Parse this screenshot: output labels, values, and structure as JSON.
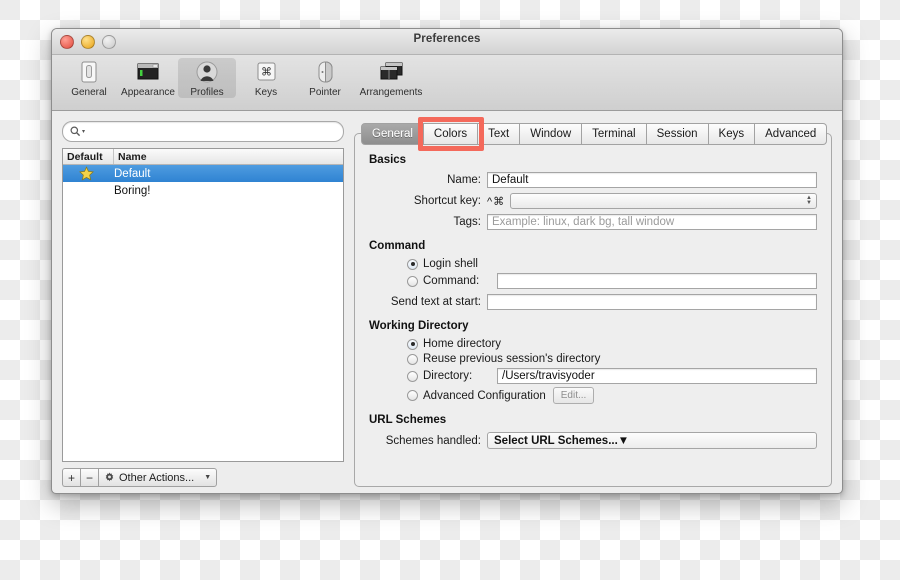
{
  "window": {
    "title": "Preferences",
    "traffic_lights": [
      "close-button",
      "minimize-button",
      "zoom-button"
    ]
  },
  "toolbar": {
    "items": [
      {
        "label": "General",
        "icon": "light-switch-icon",
        "active": false
      },
      {
        "label": "Appearance",
        "icon": "terminal-window-icon",
        "active": false
      },
      {
        "label": "Profiles",
        "icon": "person-silhouette-icon",
        "active": true
      },
      {
        "label": "Keys",
        "icon": "command-key-icon",
        "active": false
      },
      {
        "label": "Pointer",
        "icon": "mouse-icon",
        "active": false
      },
      {
        "label": "Arrangements",
        "icon": "stacked-windows-icon",
        "active": false
      }
    ]
  },
  "sidebar": {
    "search": {
      "placeholder": "",
      "value": "",
      "icon": "search-icon"
    },
    "columns": [
      "Default",
      "Name"
    ],
    "rows": [
      {
        "name": "Default",
        "starred": true,
        "selected": true
      },
      {
        "name": "Boring!",
        "starred": false,
        "selected": false
      }
    ],
    "bottom_bar": {
      "add_label": "+",
      "remove_label": "−",
      "other_actions_label": "Other Actions...",
      "gear_icon": "gear-icon",
      "caret_icon": "chevron-down-icon"
    }
  },
  "tabs": [
    {
      "label": "General",
      "selected": true,
      "highlighted": false
    },
    {
      "label": "Colors",
      "selected": false,
      "highlighted": true
    },
    {
      "label": "Text",
      "selected": false,
      "highlighted": false
    },
    {
      "label": "Window",
      "selected": false,
      "highlighted": false
    },
    {
      "label": "Terminal",
      "selected": false,
      "highlighted": false
    },
    {
      "label": "Session",
      "selected": false,
      "highlighted": false
    },
    {
      "label": "Keys",
      "selected": false,
      "highlighted": false
    },
    {
      "label": "Advanced",
      "selected": false,
      "highlighted": false
    }
  ],
  "highlight": {
    "color": "#f4695b",
    "target": "Colors"
  },
  "basics": {
    "heading": "Basics",
    "name_label": "Name:",
    "name_value": "Default",
    "shortcut_label": "Shortcut key:",
    "shortcut_modifiers": "^⌘",
    "shortcut_value": "",
    "tags_label": "Tags:",
    "tags_placeholder": "Example: linux, dark bg, tall window"
  },
  "command": {
    "heading": "Command",
    "login_shell_label": "Login shell",
    "login_shell_selected": true,
    "command_label": "Command:",
    "command_selected": false,
    "command_value": "",
    "send_text_label": "Send text at start:",
    "send_text_value": ""
  },
  "working_directory": {
    "heading": "Working Directory",
    "options": [
      {
        "label": "Home directory",
        "selected": true
      },
      {
        "label": "Reuse previous session's directory",
        "selected": false
      },
      {
        "label": "Directory:",
        "selected": false
      },
      {
        "label": "Advanced Configuration",
        "selected": false
      }
    ],
    "directory_value": "/Users/travisyoder",
    "edit_button_label": "Edit..."
  },
  "url_schemes": {
    "heading": "URL Schemes",
    "schemes_label": "Schemes handled:",
    "schemes_value": "Select URL Schemes..."
  },
  "colors": {
    "selection_blue": "#2f83d2",
    "star_yellow": "#f3d24a",
    "highlight_red": "#f4695b"
  }
}
